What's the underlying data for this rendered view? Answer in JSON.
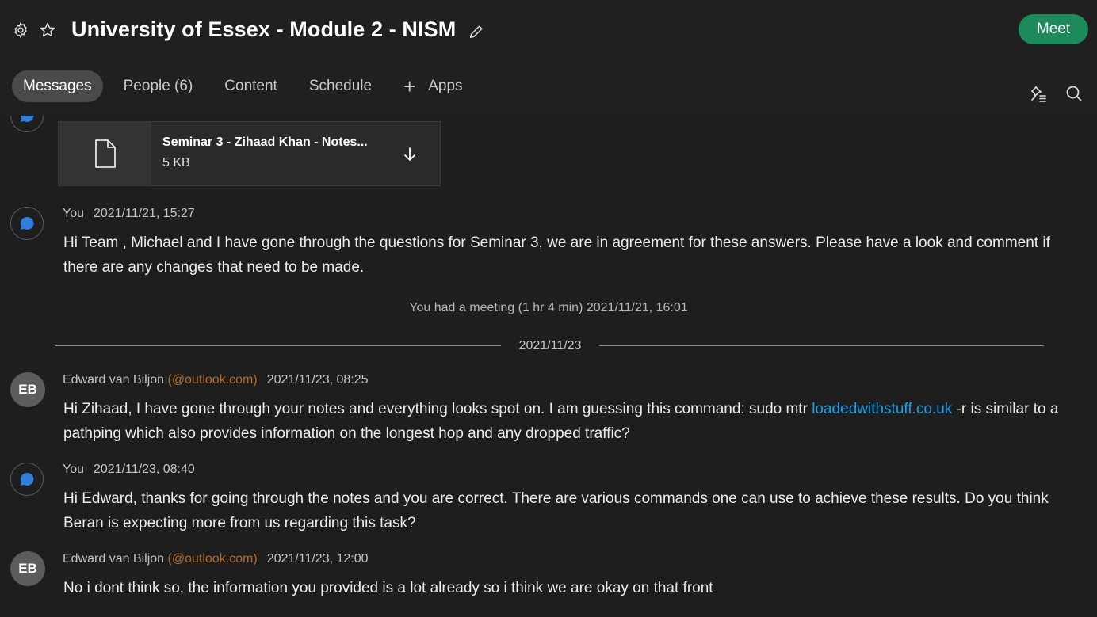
{
  "header": {
    "title": "University of Essex - Module 2 - NISM",
    "meet_label": "Meet"
  },
  "tabs": [
    {
      "label": "Messages",
      "active": true
    },
    {
      "label": "People (6)",
      "active": false
    },
    {
      "label": "Content",
      "active": false
    },
    {
      "label": "Schedule",
      "active": false
    },
    {
      "label": "Apps",
      "active": false
    }
  ],
  "file": {
    "name": "Seminar 3 - Zihaad Khan - Notes...",
    "size": "5 KB"
  },
  "messages": [
    {
      "author": "You",
      "email": "",
      "timestamp": "2021/11/21, 15:27",
      "text": "Hi Team , Michael and I have gone through the questions for Seminar 3, we are in agreement for these answers. Please have a look and comment if there are any changes that need to be made."
    },
    {
      "author": "Edward van Biljon",
      "avatar_initials": "EB",
      "email": "(@outlook.com)",
      "timestamp": "2021/11/23, 08:25",
      "text_before_link": "Hi Zihaad, I have gone through your notes and everything looks spot on. I am guessing this command: sudo mtr ",
      "link": "loadedwithstuff.co.uk",
      "text_after_link": " -r is similar to a pathping which also provides information on the longest hop and any dropped traffic?"
    },
    {
      "author": "You",
      "email": "",
      "timestamp": "2021/11/23, 08:40",
      "text": "Hi Edward, thanks for going through the notes and you are correct. There are various commands one can use to achieve these results.  Do you think Beran is expecting more from us regarding this task?"
    },
    {
      "author": "Edward van Biljon",
      "avatar_initials": "EB",
      "email": "(@outlook.com)",
      "timestamp": "2021/11/23, 12:00",
      "text": "No i dont think so, the information you provided is a lot already so i think we are okay on that front"
    }
  ],
  "system": {
    "meeting_text": "You had a meeting (1 hr 4 min) 2021/11/21, 16:01",
    "date_divider": "2021/11/23"
  },
  "colors": {
    "background": "#1e1e1e",
    "meet_button": "#1c8a5a",
    "link": "#1aa0e8",
    "email": "#b06a2a",
    "active_tab": "#4a4a4a"
  }
}
